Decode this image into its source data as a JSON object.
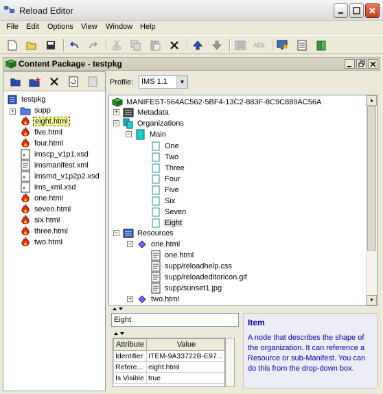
{
  "window": {
    "title": "Reload Editor"
  },
  "menu": [
    "File",
    "Edit",
    "Options",
    "View",
    "Window",
    "Help"
  ],
  "toolbar": {
    "adl_label": "ADL"
  },
  "panel": {
    "title": "Content Package - testpkg"
  },
  "left_tree": {
    "root": "testpkg",
    "items": [
      {
        "label": "supp",
        "type": "folder"
      },
      {
        "label": "eight.html",
        "type": "html",
        "selected": true
      },
      {
        "label": "five.html",
        "type": "html"
      },
      {
        "label": "four.html",
        "type": "html"
      },
      {
        "label": "imscp_v1p1.xsd",
        "type": "xsd"
      },
      {
        "label": "imsmanifest.xml",
        "type": "xml"
      },
      {
        "label": "imsmd_v1p2p2.xsd",
        "type": "xsd"
      },
      {
        "label": "ims_xml.xsd",
        "type": "xsd"
      },
      {
        "label": "one.html",
        "type": "html"
      },
      {
        "label": "seven.html",
        "type": "html"
      },
      {
        "label": "six.html",
        "type": "html"
      },
      {
        "label": "three.html",
        "type": "html"
      },
      {
        "label": "two.html",
        "type": "html"
      }
    ]
  },
  "profile": {
    "label": "Profile:",
    "value": "IMS 1.1"
  },
  "manifest_tree": {
    "manifest": "MANIFEST-564AC562-5BF4-13C2-883F-8C9C889AC56A",
    "metadata": "Metadata",
    "organizations": "Organizations",
    "main": "Main",
    "items": [
      "One",
      "Two",
      "Three",
      "Four",
      "Five",
      "Six",
      "Seven",
      "Eight"
    ],
    "resources": "Resources",
    "res_one": "one.html",
    "res_files": [
      "one.html",
      "supp/reloadhelp.css",
      "supp/reloadeditoricon.gif",
      "supp/sunset1.jpg"
    ],
    "res_two": "two.html"
  },
  "editor": {
    "name_value": "Eight",
    "columns": [
      "Attribute",
      "Value"
    ],
    "rows": [
      [
        "Identifier",
        "ITEM-9A33722B-E97..."
      ],
      [
        "Refere...",
        "eight.html"
      ],
      [
        "Is Visible",
        "true"
      ]
    ]
  },
  "help": {
    "title": "Item",
    "text": "A node that describes the shape of the organization. It can reference a Resource or sub-Manifest. You can do this from the drop-down box."
  },
  "colors": {
    "help_text": "#0000b0",
    "selection": "#ffff99",
    "html_icon": "#e03010"
  }
}
